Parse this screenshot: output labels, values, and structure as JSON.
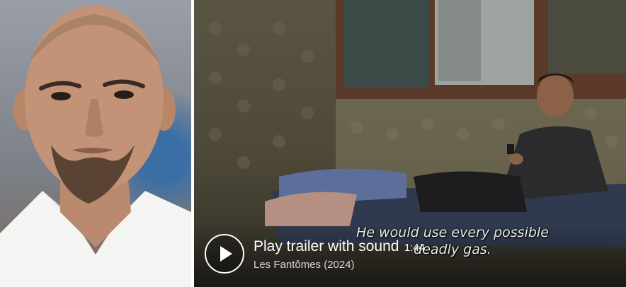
{
  "trailer": {
    "play_label": "Play trailer with sound",
    "duration": "1:44",
    "film": "Les Fantômes (2024)",
    "subtitle_line1": "He would use every possible",
    "subtitle_line2": "deadly gas."
  },
  "colors": {
    "scene_wall": "#4d4838",
    "portrait_background": "#8a8d94",
    "play_ring": "#ffffff"
  }
}
